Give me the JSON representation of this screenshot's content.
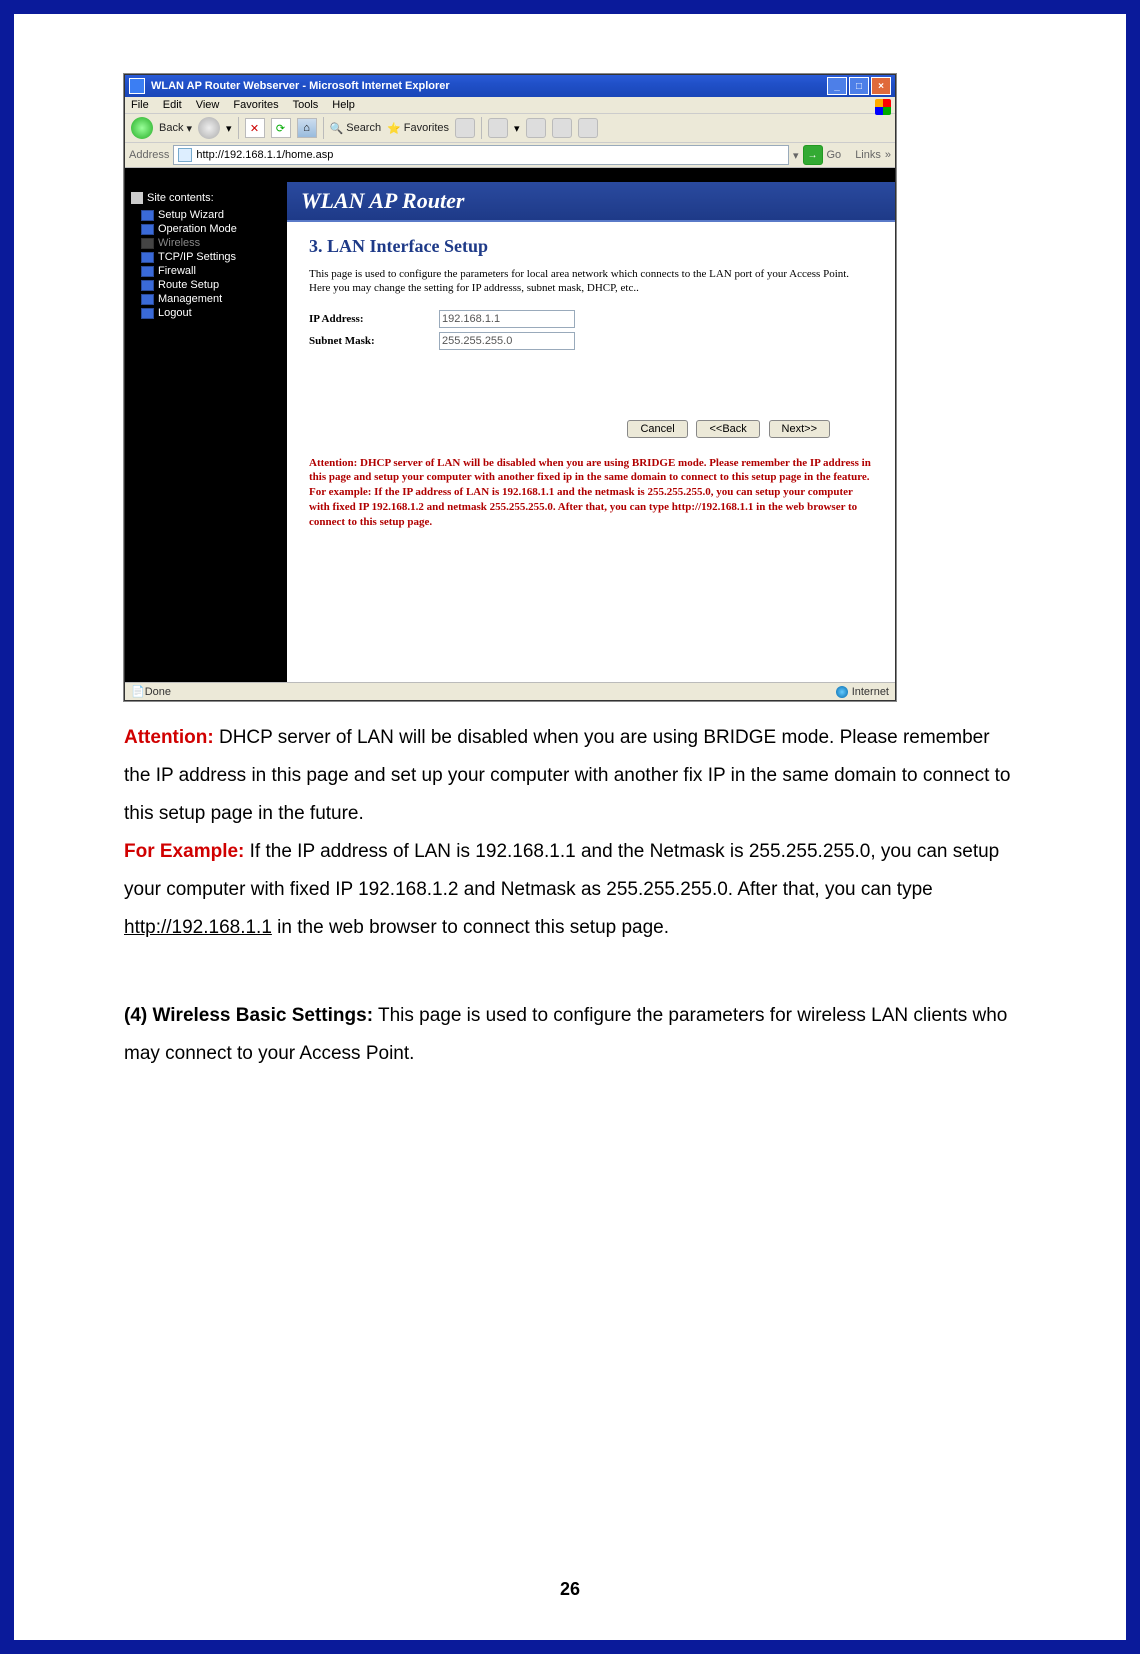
{
  "browser": {
    "title": "WLAN AP Router Webserver - Microsoft Internet Explorer",
    "menus": [
      "File",
      "Edit",
      "View",
      "Favorites",
      "Tools",
      "Help"
    ],
    "toolbar": {
      "back": "Back",
      "search": "Search",
      "favorites": "Favorites"
    },
    "address_label": "Address",
    "url": "http://192.168.1.1/home.asp",
    "go": "Go",
    "links": "Links",
    "status_left": "Done",
    "status_right": "Internet"
  },
  "router": {
    "banner": "WLAN AP Router",
    "sidebar_header": "Site contents:",
    "sidebar_items": [
      {
        "label": "Setup Wizard",
        "dim": false
      },
      {
        "label": "Operation Mode",
        "dim": false
      },
      {
        "label": "Wireless",
        "dim": true
      },
      {
        "label": "TCP/IP Settings",
        "dim": false
      },
      {
        "label": "Firewall",
        "dim": false
      },
      {
        "label": "Route Setup",
        "dim": false
      },
      {
        "label": "Management",
        "dim": false
      },
      {
        "label": "Logout",
        "dim": false
      }
    ],
    "page_title": "3. LAN Interface Setup",
    "page_desc": "This page is used to configure the parameters for local area network which connects to the LAN port of your Access Point. Here you may change the setting for IP addresss, subnet mask, DHCP, etc..",
    "ip_label": "IP Address:",
    "ip_value": "192.168.1.1",
    "mask_label": "Subnet Mask:",
    "mask_value": "255.255.255.0",
    "btn_cancel": "Cancel",
    "btn_back": "<<Back",
    "btn_next": "Next>>",
    "attention": "Attention: DHCP server of LAN will be disabled when you are using BRIDGE mode. Please remember the IP address in this page and setup your computer with another fixed ip in the same domain to connect to this setup page in the feature.\nFor example: If the IP address of LAN is 192.168.1.1 and the netmask is 255.255.255.0, you can setup your computer with fixed IP 192.168.1.2 and netmask 255.255.255.0. After that, you can type http://192.168.1.1 in the web browser to connect to this setup page."
  },
  "doc": {
    "attention_label": "Attention:",
    "attention_text": " DHCP server of LAN will be disabled when you are using BRIDGE mode. Please remember the IP address in this page and set up your computer with another fix IP in the same domain to connect to this setup page in the future.",
    "example_label": "For Example:",
    "example_text_1": " If the IP address of LAN is 192.168.1.1 and the Netmask is 255.255.255.0, you can setup your computer with fixed IP 192.168.1.2 and Netmask as 255.255.255.0. After that, you can type ",
    "example_link": "http://192.168.1.1",
    "example_text_2": " in the web browser to connect this setup page.",
    "section4_label": "(4) Wireless Basic Settings:",
    "section4_text": " This page is used to configure the parameters for wireless LAN clients who may connect to your Access Point.",
    "page_number": "26"
  }
}
